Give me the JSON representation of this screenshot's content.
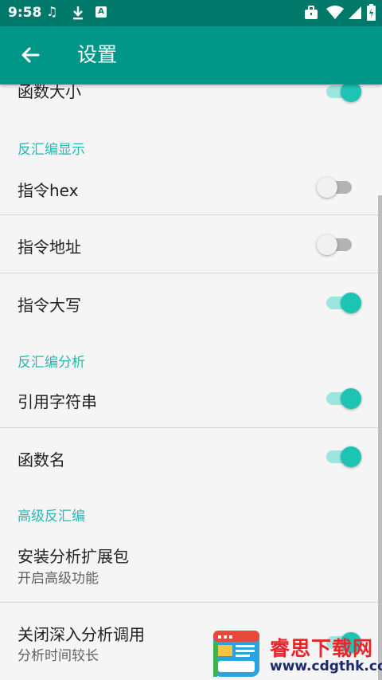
{
  "status_bar": {
    "time": "9:58"
  },
  "toolbar": {
    "title": "设置"
  },
  "items": {
    "func_size": "函数大小",
    "header_display": "反汇编显示",
    "hex": "指令hex",
    "address": "指令地址",
    "upper": "指令大写",
    "header_analysis": "反汇编分析",
    "ref_strings": "引用字符串",
    "func_name": "函数名",
    "header_advanced": "高级反汇编",
    "install_pack": "安装分析扩展包",
    "install_pack_sub": "开启高级功能",
    "deep_analysis": "关闭深入分析调用",
    "deep_analysis_sub": "分析时间较长"
  },
  "switches": {
    "func_size": true,
    "hex": false,
    "address": false,
    "upper": true,
    "ref_strings": true,
    "func_name": true,
    "deep_analysis": true
  },
  "watermark": {
    "name": "睿思下载网",
    "url": "www.cdgthk.com"
  },
  "colors": {
    "toolbar": "#009688",
    "statusbar": "#00796b",
    "accent": "#1dc4b4",
    "header": "#26b8b2"
  }
}
